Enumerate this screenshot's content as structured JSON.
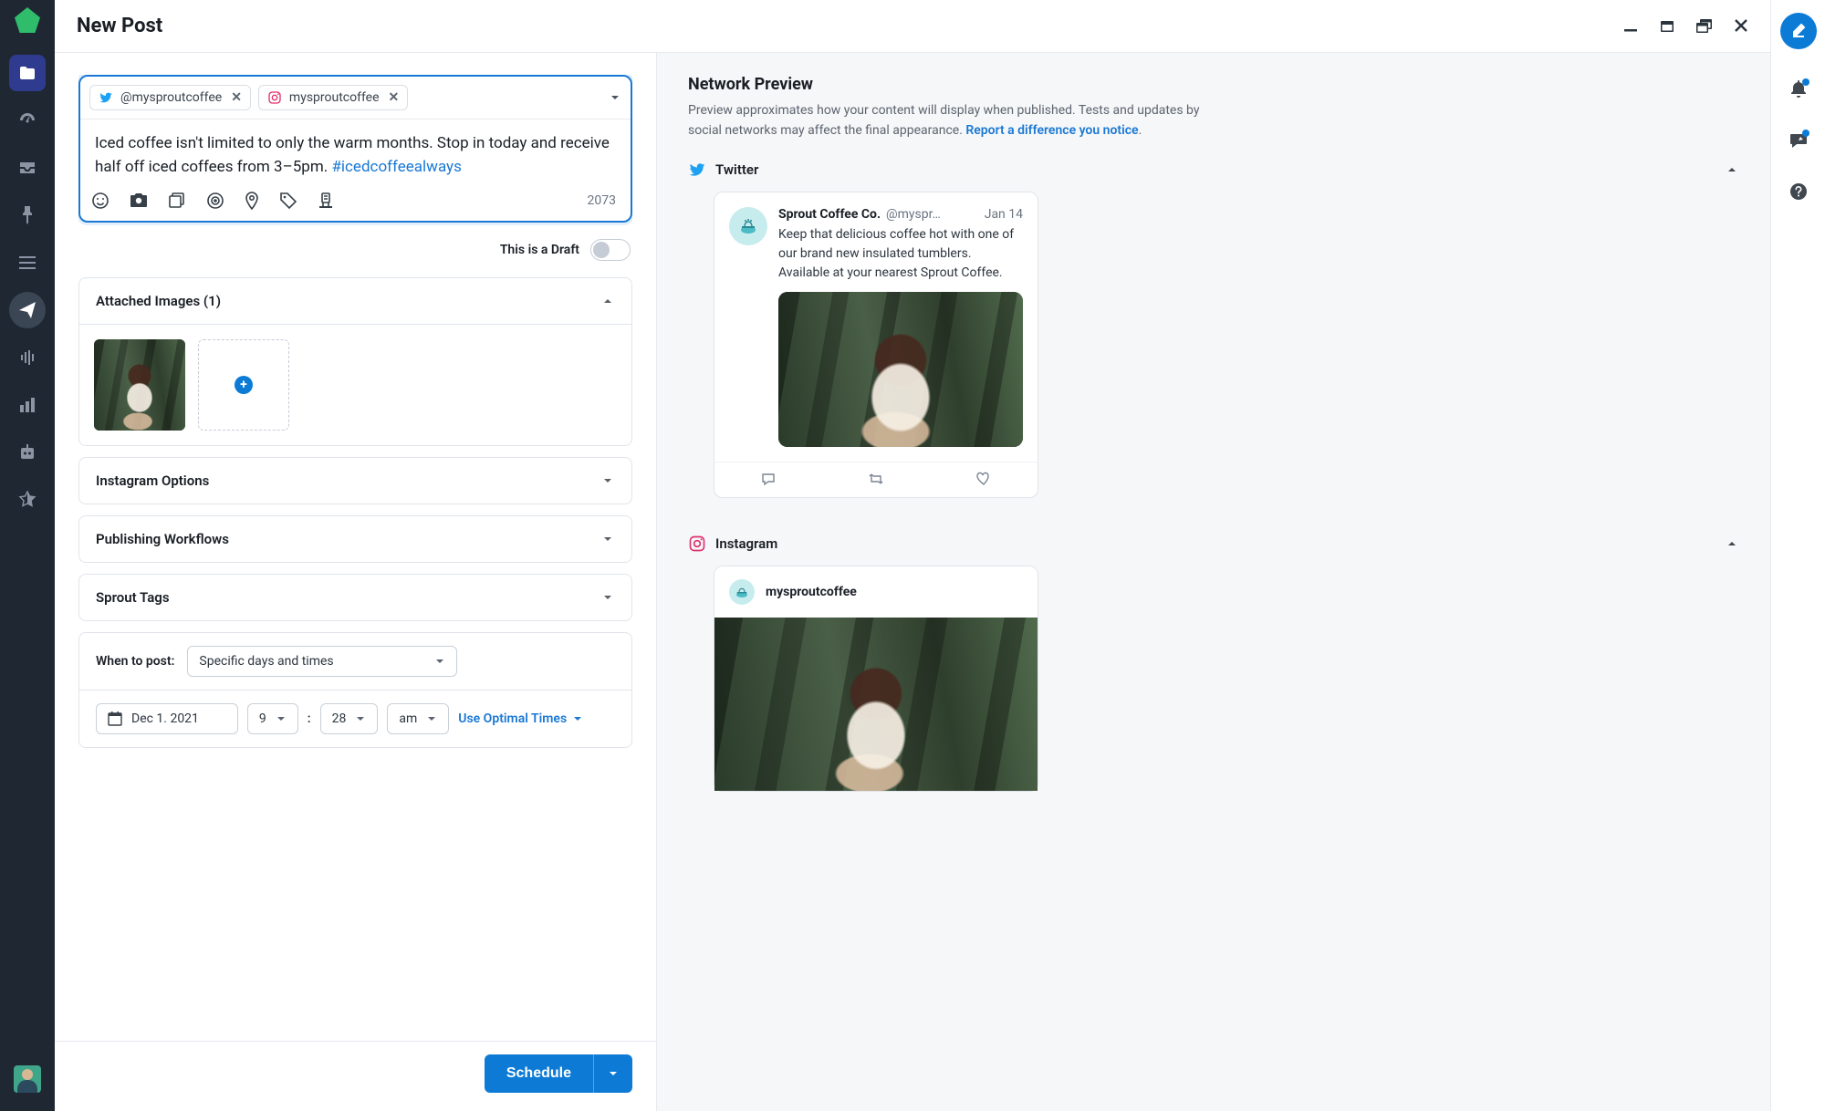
{
  "header": {
    "title": "New Post"
  },
  "composer": {
    "profiles": [
      {
        "network": "twitter",
        "handle": "@mysproutcoffee"
      },
      {
        "network": "instagram",
        "handle": "mysproutcoffee"
      }
    ],
    "text_plain": "Iced coffee isn't limited to only the warm months. Stop in today and receive half off iced coffees from 3–5pm. ",
    "hashtag": "#icedcoffeealways",
    "char_count": "2073"
  },
  "draft": {
    "label": "This is a Draft",
    "enabled": false
  },
  "sections": {
    "attached_images": {
      "label": "Attached Images (1)",
      "count": 1
    },
    "instagram_options": {
      "label": "Instagram Options"
    },
    "publishing_workflows": {
      "label": "Publishing Workflows"
    },
    "sprout_tags": {
      "label": "Sprout Tags"
    }
  },
  "scheduling": {
    "when_label": "When to post:",
    "when_mode": "Specific days and times",
    "date": "Dec 1. 2021",
    "hour": "9",
    "minute": "28",
    "ampm": "am",
    "optimal_link": "Use Optimal Times"
  },
  "footer": {
    "schedule_label": "Schedule"
  },
  "preview": {
    "title": "Network Preview",
    "description": "Preview approximates how your content will display when published. Tests and updates by social networks may affect the final appearance. ",
    "report_link": "Report a difference you notice",
    "twitter_label": "Twitter",
    "instagram_label": "Instagram",
    "twitter": {
      "name": "Sprout Coffee Co.",
      "handle": "@myspr…",
      "date": "Jan 14",
      "text": "Keep that delicious coffee hot with one of our brand new insulated tumblers. Available at your nearest Sprout Coffee."
    },
    "instagram": {
      "username": "mysproutcoffee"
    }
  }
}
